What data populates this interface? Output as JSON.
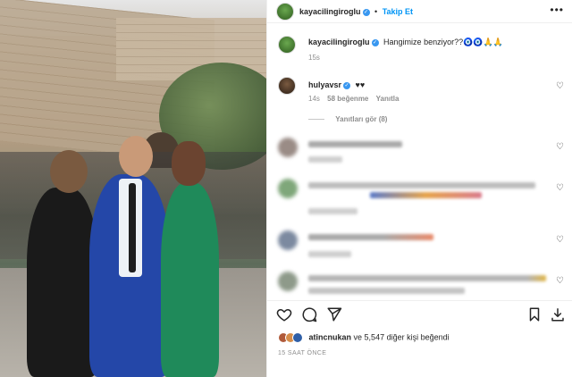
{
  "post": {
    "author": "kayacilingiroglu",
    "follow_label": "Takip Et",
    "separator": "•",
    "more": "•••"
  },
  "caption": {
    "username": "kayacilingiroglu",
    "text": "Hangimize benziyor??🧿🧿🙏🙏",
    "time": "15s"
  },
  "comment": {
    "username": "hulyavsr",
    "text": "♥♥",
    "time": "14s",
    "likes": "58 beğenme",
    "reply": "Yanıtla",
    "view_replies": "Yanıtları gör (8)"
  },
  "likes": {
    "first_user": "atincnukan",
    "rest": "ve 5,547 diğer kişi beğendi"
  },
  "timestamp": "15 SAAT ÖNCE",
  "colors": {
    "accent": "#0095f6",
    "verified": "#3897f0",
    "muted": "#8e8e8e"
  }
}
